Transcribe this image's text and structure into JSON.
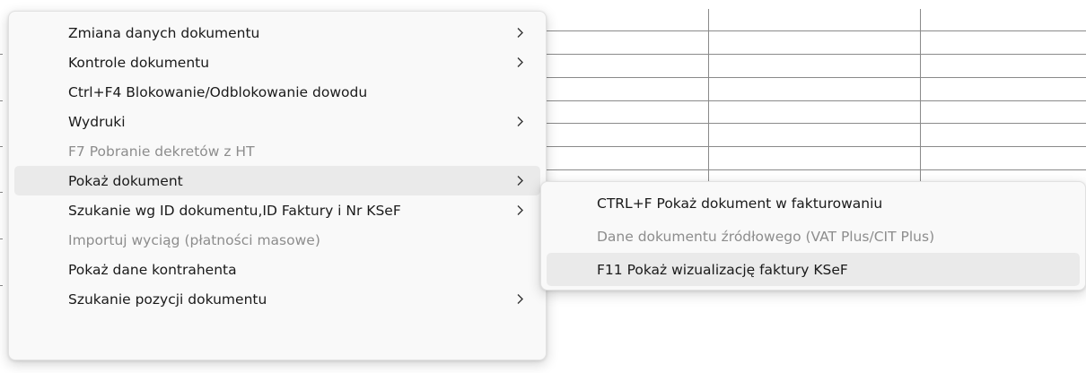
{
  "menu": {
    "items": [
      {
        "label": "Zmiana danych dokumentu",
        "submenu": true,
        "disabled": false
      },
      {
        "label": "Kontrole dokumentu",
        "submenu": true,
        "disabled": false
      },
      {
        "label": "Ctrl+F4 Blokowanie/Odblokowanie dowodu",
        "submenu": false,
        "disabled": false
      },
      {
        "label": "Wydruki",
        "submenu": true,
        "disabled": false
      },
      {
        "label": "F7 Pobranie dekretów z HT",
        "submenu": false,
        "disabled": true
      },
      {
        "label": "Pokaż dokument",
        "submenu": true,
        "disabled": false,
        "highlighted": true
      },
      {
        "label": "Szukanie wg ID dokumentu,ID Faktury i Nr KSeF",
        "submenu": true,
        "disabled": false
      },
      {
        "label": "Importuj wyciąg (płatności masowe)",
        "submenu": false,
        "disabled": true
      },
      {
        "label": "Pokaż dane kontrahenta",
        "submenu": false,
        "disabled": false
      },
      {
        "label": "Szukanie pozycji dokumentu",
        "submenu": true,
        "disabled": false
      }
    ]
  },
  "submenu": {
    "items": [
      {
        "label": "CTRL+F Pokaż dokument w fakturowaniu",
        "disabled": false
      },
      {
        "label": "Dane dokumentu źródłowego (VAT Plus/CIT Plus)",
        "disabled": true
      },
      {
        "label": "F11 Pokaż wizualizację faktury KSeF",
        "disabled": false,
        "highlighted": true
      }
    ]
  },
  "colors": {
    "menu_bg": "#f9f9f9",
    "highlight": "#eaeaea",
    "disabled_text": "#8d8d8d",
    "grid_line": "#8a8a8a"
  },
  "icons": {
    "submenu_indicator": "chevron-right-icon"
  }
}
